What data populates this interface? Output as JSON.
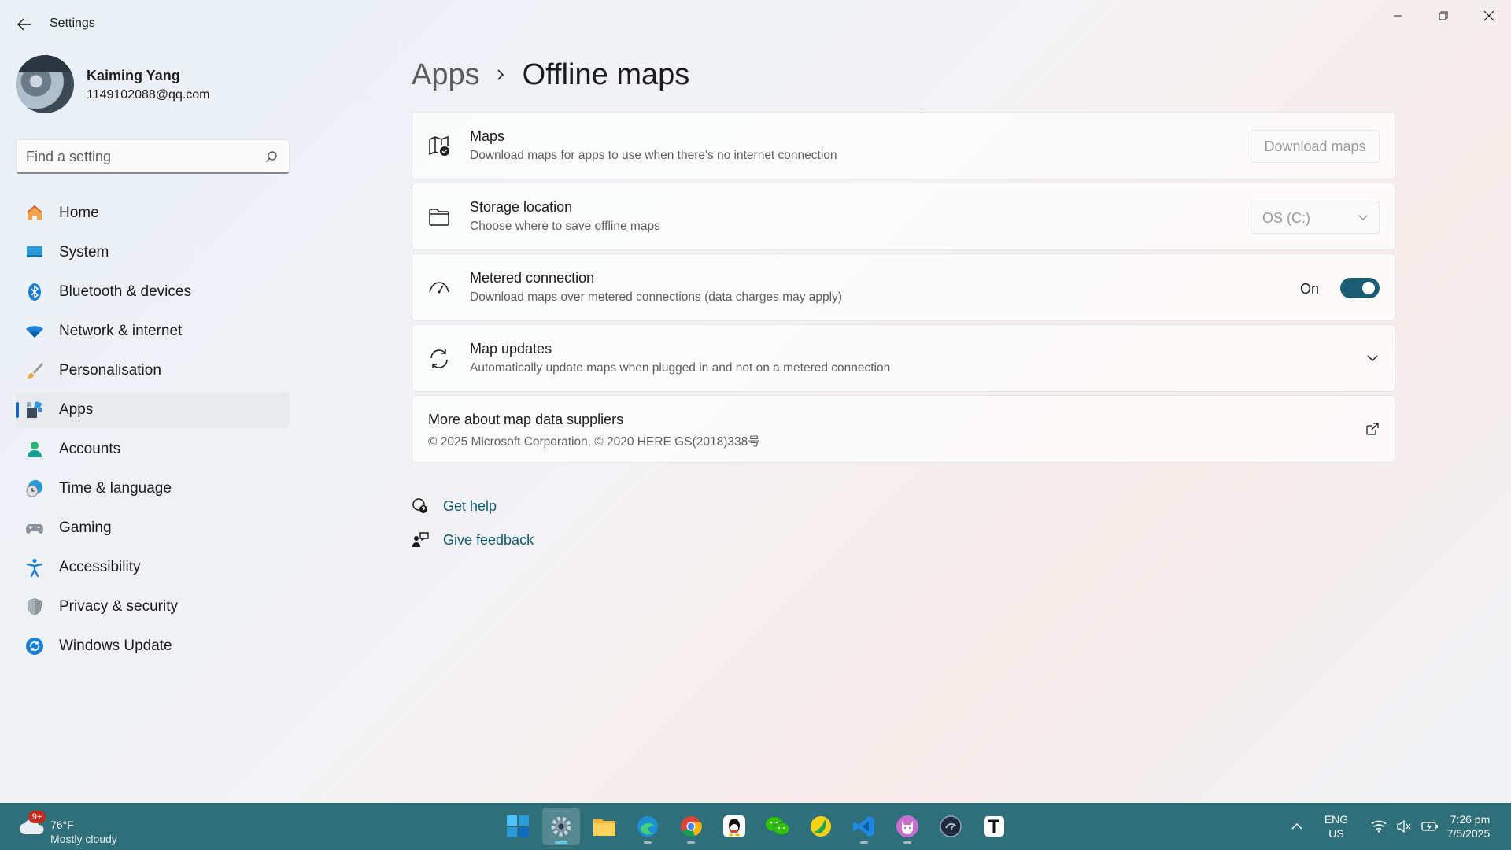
{
  "window": {
    "title": "Settings"
  },
  "profile": {
    "name": "Kaiming Yang",
    "email": "1149102088@qq.com"
  },
  "search": {
    "placeholder": "Find a setting"
  },
  "nav": {
    "items": [
      {
        "label": "Home",
        "icon": "home-icon",
        "active": false
      },
      {
        "label": "System",
        "icon": "system-icon",
        "active": false
      },
      {
        "label": "Bluetooth & devices",
        "icon": "bluetooth-icon",
        "active": false
      },
      {
        "label": "Network & internet",
        "icon": "wifi-icon",
        "active": false
      },
      {
        "label": "Personalisation",
        "icon": "brush-icon",
        "active": false
      },
      {
        "label": "Apps",
        "icon": "apps-icon",
        "active": true
      },
      {
        "label": "Accounts",
        "icon": "account-icon",
        "active": false
      },
      {
        "label": "Time & language",
        "icon": "clock-globe-icon",
        "active": false
      },
      {
        "label": "Gaming",
        "icon": "gamepad-icon",
        "active": false
      },
      {
        "label": "Accessibility",
        "icon": "accessibility-icon",
        "active": false
      },
      {
        "label": "Privacy & security",
        "icon": "shield-icon",
        "active": false
      },
      {
        "label": "Windows Update",
        "icon": "update-icon",
        "active": false
      }
    ]
  },
  "breadcrumb": {
    "parent": "Apps",
    "current": "Offline maps"
  },
  "cards": {
    "maps": {
      "title": "Maps",
      "description": "Download maps for apps to use when there's no internet connection",
      "button": "Download maps"
    },
    "storage": {
      "title": "Storage location",
      "description": "Choose where to save offline maps",
      "value": "OS (C:)"
    },
    "metered": {
      "title": "Metered connection",
      "description": "Download maps over metered connections (data charges may apply)",
      "state_label": "On",
      "on": true
    },
    "updates": {
      "title": "Map updates",
      "description": "Automatically update maps when plugged in and not on a metered connection"
    },
    "suppliers": {
      "title": "More about map data suppliers",
      "description": "© 2025 Microsoft Corporation, © 2020 HERE GS(2018)338号"
    }
  },
  "help": {
    "get_help": "Get help",
    "feedback": "Give feedback"
  },
  "taskbar": {
    "weather": {
      "badge": "9+",
      "temp": "76°F",
      "desc": "Mostly cloudy"
    },
    "apps": [
      "start-icon",
      "settings-icon",
      "file-explorer-icon",
      "edge-icon",
      "chrome-icon",
      "qq-icon",
      "wechat-icon",
      "app-green-icon",
      "vscode-icon",
      "cat-app-icon",
      "app-dark-icon",
      "typora-icon"
    ],
    "lang": {
      "line1": "ENG",
      "line2": "US"
    },
    "clock": {
      "time": "7:26 pm",
      "date": "7/5/2025"
    }
  },
  "colors": {
    "accent": "#0f6cbd",
    "toggle": "#1b5e73",
    "link": "#0c5a73",
    "taskbar": "#2f6f7a"
  }
}
